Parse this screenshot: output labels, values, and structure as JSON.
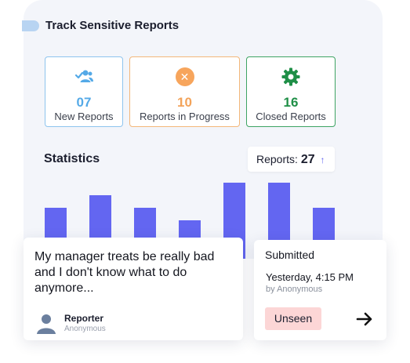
{
  "header": {
    "title": "Track Sensitive Reports"
  },
  "cards": {
    "new": {
      "value": "07",
      "label": "New Reports",
      "icon": "users-check-icon",
      "color": "#54a9e7"
    },
    "progress": {
      "value": "10",
      "label": "Reports in Progress",
      "icon": "x-circle-icon",
      "color": "#f3a35a"
    },
    "closed": {
      "value": "16",
      "label": "Closed Reports",
      "icon": "gear-icon",
      "color": "#1f8f47"
    }
  },
  "statistics": {
    "title": "Statistics",
    "reports_label": "Reports:",
    "reports_count": "27",
    "trend_icon": "arrow-up-icon"
  },
  "chart_data": {
    "type": "bar",
    "values": [
      8,
      10,
      8,
      6,
      12,
      12,
      8
    ],
    "color": "#6366f1"
  },
  "message": {
    "text": "My manager treats be really bad and I don't know what to do anymore...",
    "reporter_name": "Reporter",
    "reporter_sub": "Anonymous"
  },
  "submission": {
    "title": "Submitted",
    "time": "Yesterday, 4:15 PM",
    "by": "by Anonymous",
    "status": "Unseen",
    "status_color": "#fcd6d6"
  }
}
